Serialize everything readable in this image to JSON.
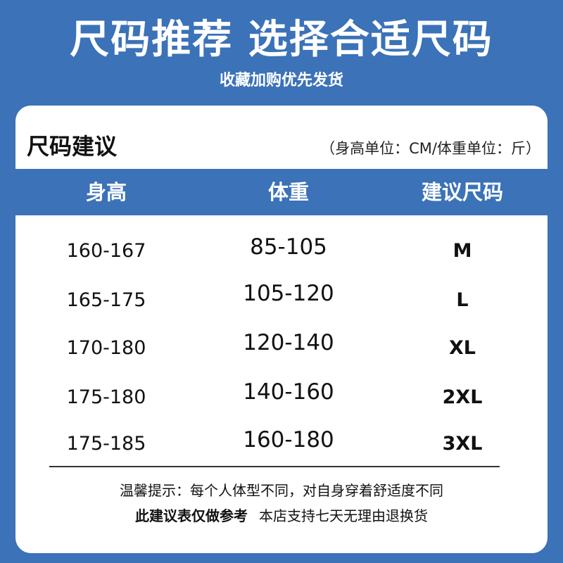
{
  "header": {
    "title": "尺码推荐 选择合适尺码",
    "subtitle": "收藏加购优先发货"
  },
  "card": {
    "title": "尺码建议",
    "unit_note": "（身高单位：CM/体重单位：斤）"
  },
  "table": {
    "columns": [
      "身高",
      "体重",
      "建议尺码"
    ],
    "rows": [
      {
        "height": "160-167",
        "weight": "85-105",
        "size": "M"
      },
      {
        "height": "165-175",
        "weight": "105-120",
        "size": "L"
      },
      {
        "height": "170-180",
        "weight": "120-140",
        "size": "XL"
      },
      {
        "height": "175-180",
        "weight": "140-160",
        "size": "2XL"
      },
      {
        "height": "175-185",
        "weight": "160-180",
        "size": "3XL"
      }
    ]
  },
  "notes": {
    "tip": "温馨提示：每个人体型不同，对自身穿着舒适度不同",
    "disclaimer": "此建议表仅做参考",
    "return_policy": "本店支持七天无理由退换货"
  },
  "colors": {
    "background": "#3b72b8",
    "card": "#ffffff"
  }
}
